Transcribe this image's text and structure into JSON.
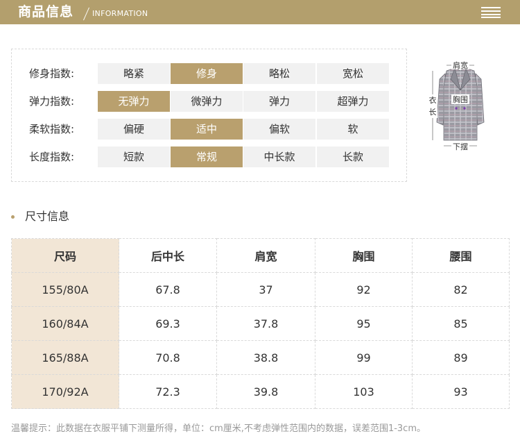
{
  "header": {
    "title": "商品信息",
    "subtitle": "INFORMATION",
    "menu_icon": "menu-icon"
  },
  "indices": [
    {
      "label": "修身指数:",
      "options": [
        "略紧",
        "修身",
        "略松",
        "宽松"
      ],
      "selected": 1
    },
    {
      "label": "弹力指数:",
      "options": [
        "无弹力",
        "微弹力",
        "弹力",
        "超弹力"
      ],
      "selected": 0
    },
    {
      "label": "柔软指数:",
      "options": [
        "偏硬",
        "适中",
        "偏软",
        "软"
      ],
      "selected": 1
    },
    {
      "label": "长度指数:",
      "options": [
        "短款",
        "常规",
        "中长款",
        "长款"
      ],
      "selected": 1
    }
  ],
  "figure": {
    "shoulder": "肩宽",
    "length": "衣长",
    "length_chars": [
      "衣",
      "长"
    ],
    "chest": "胸围",
    "hem": "下摆"
  },
  "size_section": {
    "title": "尺寸信息"
  },
  "size_table": {
    "headers": [
      "尺码",
      "后中长",
      "肩宽",
      "胸围",
      "腰围"
    ],
    "rows": [
      [
        "155/80A",
        "67.8",
        "37",
        "92",
        "82"
      ],
      [
        "160/84A",
        "69.3",
        "37.8",
        "95",
        "85"
      ],
      [
        "165/88A",
        "70.8",
        "38.8",
        "99",
        "89"
      ],
      [
        "170/92A",
        "72.3",
        "39.8",
        "103",
        "93"
      ]
    ]
  },
  "note": "温馨提示：此数据在衣服平铺下测量所得，单位：cm厘米,不考虑弹性范围内的数据，误差范围1-3cm。",
  "colors": {
    "accent": "#b39f6d",
    "selected": "#b9a06e",
    "option_bg": "#f1f1f1",
    "table_first_col": "#f2e6d6",
    "note_text": "#999999"
  }
}
